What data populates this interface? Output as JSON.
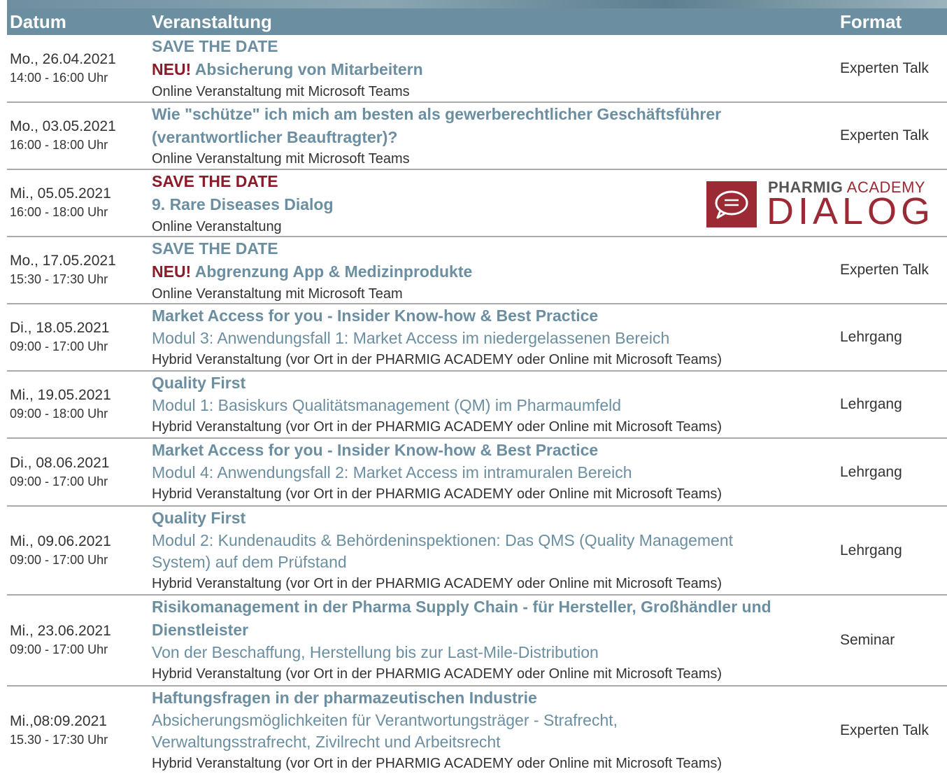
{
  "header": {
    "date": "Datum",
    "event": "Veranstaltung",
    "format": "Format"
  },
  "logo": {
    "brand": "PHARMIG",
    "academy": "ACADEMY",
    "dialog": "DIALOG",
    "color": "#9b2a35"
  },
  "rows": [
    {
      "date": "Mo., 26.04.2021",
      "time": "14:00 - 16:00 Uhr",
      "save": "SAVE THE DATE",
      "neu": "NEU!",
      "title": "Absicherung von Mitarbeitern",
      "location": "Online Veranstaltung mit Microsoft Teams",
      "format": "Experten Talk"
    },
    {
      "date": "Mo., 03.05.2021",
      "time": "16:00 - 18:00 Uhr",
      "title1": "Wie \"schütze\" ich mich am besten als gewerberechtlicher Geschäftsführer",
      "title2": "(verantwortlicher Beauftragter)?",
      "location": "Online Veranstaltung mit Microsoft Teams",
      "format": "Experten Talk"
    },
    {
      "date": "Mi., 05.05.2021",
      "time": "16:00 - 18:00 Uhr",
      "save": "SAVE THE DATE",
      "title": "9. Rare Diseases Dialog",
      "location": "Online Veranstaltung"
    },
    {
      "date": "Mo., 17.05.2021",
      "time": "15:30 - 17:30 Uhr",
      "save": "SAVE THE DATE",
      "neu": "NEU!",
      "title": "Abgrenzung App & Medizinprodukte",
      "location": "Online Veranstaltung mit Microsoft Team",
      "format": "Experten Talk"
    },
    {
      "date": "Di., 18.05.2021",
      "time": "09:00 - 17:00 Uhr",
      "title": "Market Access for you - Insider Know-how & Best Practice",
      "sub": "Modul 3: Anwendungsfall 1: Market Access im niedergelassenen Bereich",
      "location": "Hybrid Veranstaltung (vor Ort in der PHARMIG ACADEMY oder Online mit Microsoft Teams)",
      "format": "Lehrgang"
    },
    {
      "date": "Mi., 19.05.2021",
      "time": "09:00 - 18:00 Uhr",
      "title": "Quality First",
      "sub": "Modul 1:  Basiskurs Qualitätsmanagement (QM) im Pharmaumfeld",
      "location": "Hybrid Veranstaltung (vor Ort in der PHARMIG ACADEMY oder Online mit Microsoft Teams)",
      "format": "Lehrgang"
    },
    {
      "date": "Di., 08.06.2021",
      "time": "09:00 - 17:00 Uhr",
      "title": "Market Access for you - Insider Know-how & Best Practice",
      "sub": "Modul 4: Anwendungsfall 2: Market Access im intramuralen Bereich",
      "location": "Hybrid Veranstaltung (vor Ort in der PHARMIG ACADEMY oder Online mit Microsoft Teams)",
      "format": "Lehrgang"
    },
    {
      "date": "Mi., 09.06.2021",
      "time": "09:00 - 17:00 Uhr",
      "title": "Quality First",
      "sub1": "Modul 2: Kundenaudits & Behördeninspektionen: Das QMS (Quality Management",
      "sub2": "System) auf dem Prüfstand",
      "location": "Hybrid Veranstaltung (vor Ort in der PHARMIG ACADEMY oder Online mit Microsoft Teams)",
      "format": "Lehrgang"
    },
    {
      "date": "Mi., 23.06.2021",
      "time": "09:00 - 17:00 Uhr",
      "title1": "Risikomanagement in der Pharma Supply Chain - für Hersteller, Großhändler und",
      "title2": "Dienstleister",
      "sub": "Von der Beschaffung, Herstellung bis zur Last-Mile-Distribution",
      "location": "Hybrid Veranstaltung (vor Ort in der PHARMIG ACADEMY oder Online mit Microsoft Teams)",
      "format": "Seminar"
    },
    {
      "date": "Mi.,08:09.2021",
      "time": "15.30 - 17:30 Uhr",
      "title": "Haftungsfragen in der pharmazeutischen Industrie",
      "sub1": "Absicherungsmöglichkeiten für Verantwortungsträger - Strafrecht,",
      "sub2": "Verwaltungsstrafrecht, Zivilrecht und Arbeitsrecht",
      "location": "Hybrid Veranstaltung (vor Ort in der PHARMIG ACADEMY oder Online mit Microsoft Teams)",
      "format": "Experten Talk"
    }
  ]
}
